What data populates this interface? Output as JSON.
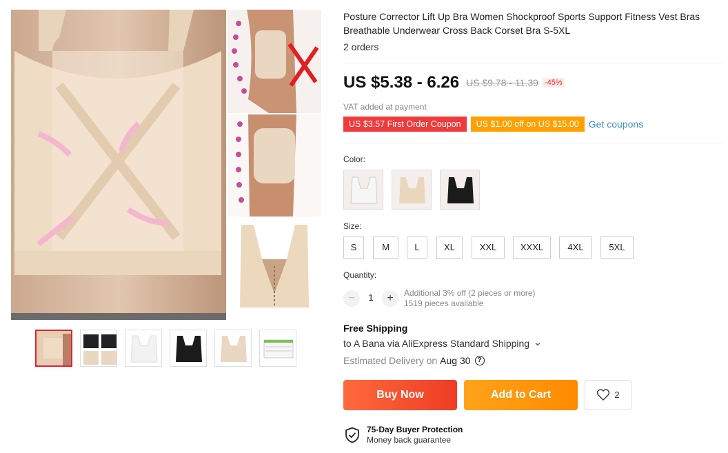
{
  "product": {
    "title": "Posture Corrector Lift Up Bra Women Shockproof Sports Support Fitness Vest Bras Breathable Underwear Cross Back Corset Bra S-5XL",
    "orders": "2 orders"
  },
  "price": {
    "current": "US $5.38 - 6.26",
    "original": "US $9.78 - 11.39",
    "discount": "-45%",
    "vat_note": "VAT added at payment"
  },
  "coupons": {
    "first_order": "US $3.57 First Order Coupon",
    "store": "US $1.00 off on US $15.00",
    "get_link": "Get coupons"
  },
  "color": {
    "label": "Color:",
    "options": [
      {
        "name": "white",
        "swatch": "#f7f7f7"
      },
      {
        "name": "nude",
        "swatch": "#e9d6bd"
      },
      {
        "name": "black",
        "swatch": "#1b1b1b"
      }
    ]
  },
  "size": {
    "label": "Size:",
    "options": [
      "S",
      "M",
      "L",
      "XL",
      "XXL",
      "XXXL",
      "4XL",
      "5XL"
    ]
  },
  "quantity": {
    "label": "Quantity:",
    "value": "1",
    "minus": "−",
    "plus": "+",
    "offer": "Additional 3% off (2 pieces or more)",
    "available": "1519 pieces available"
  },
  "shipping": {
    "title": "Free Shipping",
    "to": "to A Bana via AliExpress Standard Shipping",
    "delivery_label": "Estimated Delivery on",
    "delivery_date": "Aug 30",
    "help_glyph": "?"
  },
  "actions": {
    "buy_now": "Buy Now",
    "add_to_cart": "Add to Cart",
    "wishlist_count": "2"
  },
  "protection": {
    "title": "75-Day Buyer Protection",
    "subtitle": "Money back guarantee"
  },
  "colors": {
    "accent_red": "#ef3b3b",
    "accent_orange": "#ffa000",
    "link_blue": "#3b8fc8",
    "bra_nude": "#e9d6bd"
  }
}
